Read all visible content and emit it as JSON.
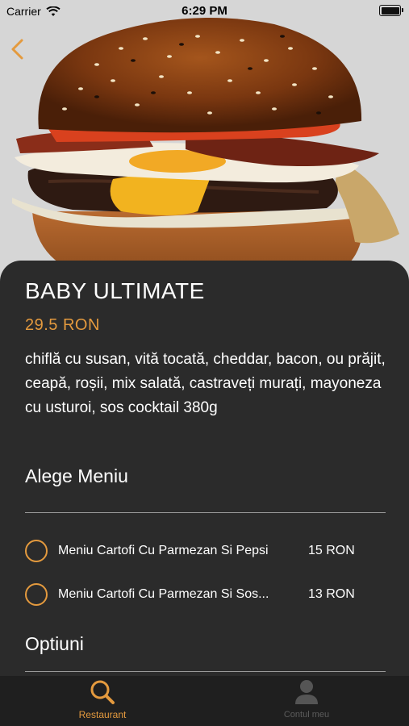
{
  "status_bar": {
    "carrier": "Carrier",
    "time": "6:29 PM"
  },
  "product": {
    "name": "BABY ULTIMATE",
    "price": "29.5 RON",
    "description": "chiflă cu susan, vită tocată, cheddar, bacon, ou prăjit, ceapă, roșii, mix salată, castraveți murați, mayoneza cu usturoi, sos cocktail 380g"
  },
  "menu_section": {
    "title": "Alege Meniu",
    "options": [
      {
        "label": "Meniu Cartofi Cu Parmezan Si Pepsi",
        "price": "15 RON"
      },
      {
        "label": "Meniu Cartofi Cu Parmezan Si Sos...",
        "price": "13 RON"
      }
    ]
  },
  "options_section": {
    "title": "Optiuni"
  },
  "tabbar": {
    "tabs": [
      {
        "label": "Restaurant",
        "icon": "search-icon",
        "active": true
      },
      {
        "label": "Contul meu",
        "icon": "person-icon",
        "active": false
      }
    ]
  },
  "colors": {
    "accent": "#e49a3e",
    "card": "#2b2b2b",
    "tabbar": "#1f1f1f"
  }
}
